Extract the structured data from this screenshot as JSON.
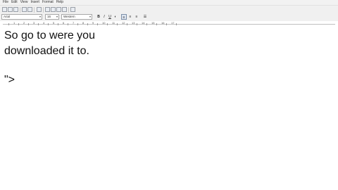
{
  "menu": [
    "File",
    "Edit",
    "View",
    "Insert",
    "Format",
    "Help"
  ],
  "format_bar": {
    "font_name": "Arial",
    "font_size": "16",
    "script": "Western"
  },
  "ruler": {
    "numbers": [
      "1",
      "2",
      "3",
      "4",
      "5",
      "6",
      "7",
      "8",
      "9",
      "10",
      "11",
      "12",
      "13",
      "14",
      "15",
      "16",
      "17"
    ]
  },
  "document": {
    "line1": "So go to were you",
    "line2": "downloaded it to.",
    "line3": "\">"
  }
}
